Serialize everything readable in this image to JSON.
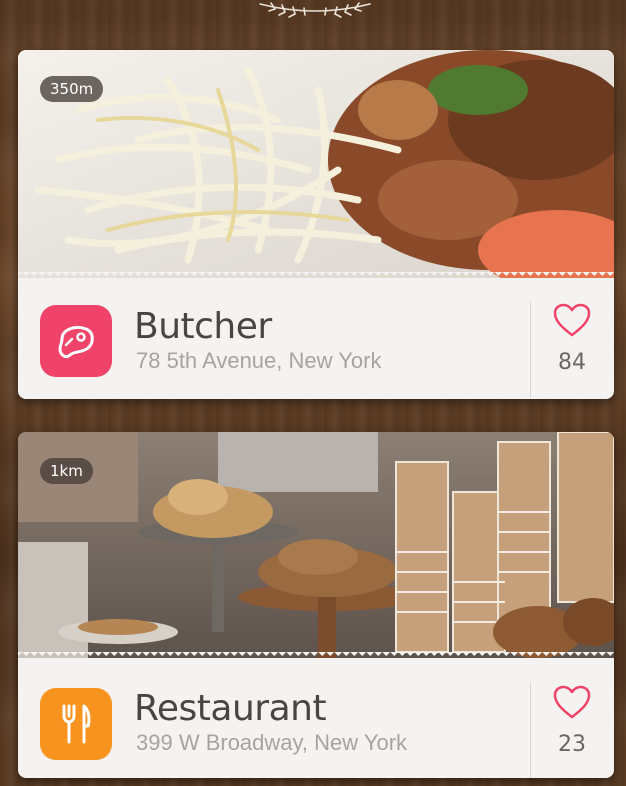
{
  "places": [
    {
      "distance": "350m",
      "name": "Butcher",
      "address": "78 5th Avenue, New York",
      "likes": "84",
      "icon": "steak-icon",
      "icon_color": "#f0436a"
    },
    {
      "distance": "1km",
      "name": "Restaurant",
      "address": "399 W Broadway, New York",
      "likes": "23",
      "icon": "fork-knife-icon",
      "icon_color": "#f7931e"
    }
  ],
  "colors": {
    "heart": "#f0436a",
    "wood": "#5a3a22"
  }
}
